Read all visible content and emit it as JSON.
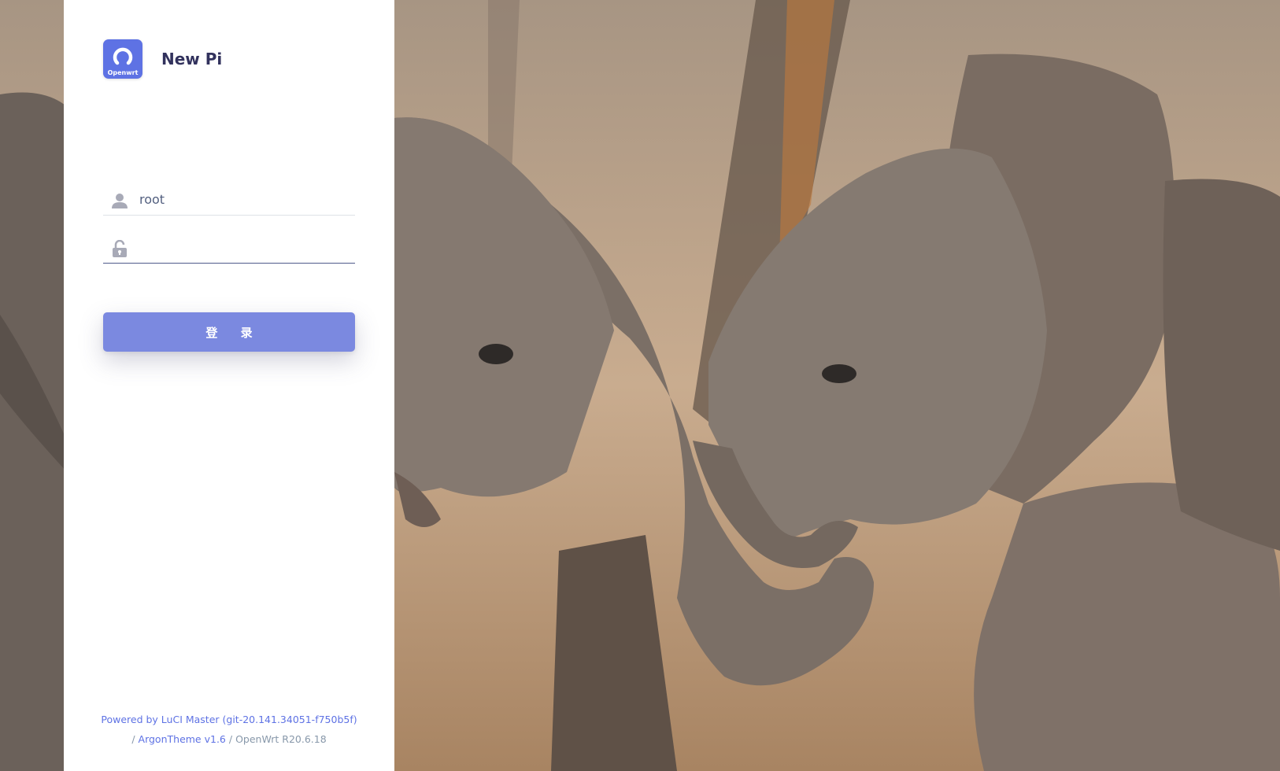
{
  "brand": {
    "logo_text": "Openwrt",
    "site_name": "New Pi"
  },
  "login": {
    "username_value": "root",
    "password_value": "",
    "submit_label": "登 录"
  },
  "footer": {
    "powered_by": "Powered by LuCI Master (git-20.141.34051-f750b5f)",
    "separator_1": "/",
    "theme": "ArgonTheme v1.6",
    "separator_2": "/",
    "firmware": "OpenWrt R20.6.18"
  },
  "colors": {
    "accent": "#5e72e4",
    "button": "#7b89e0",
    "site_name": "#32325d"
  }
}
